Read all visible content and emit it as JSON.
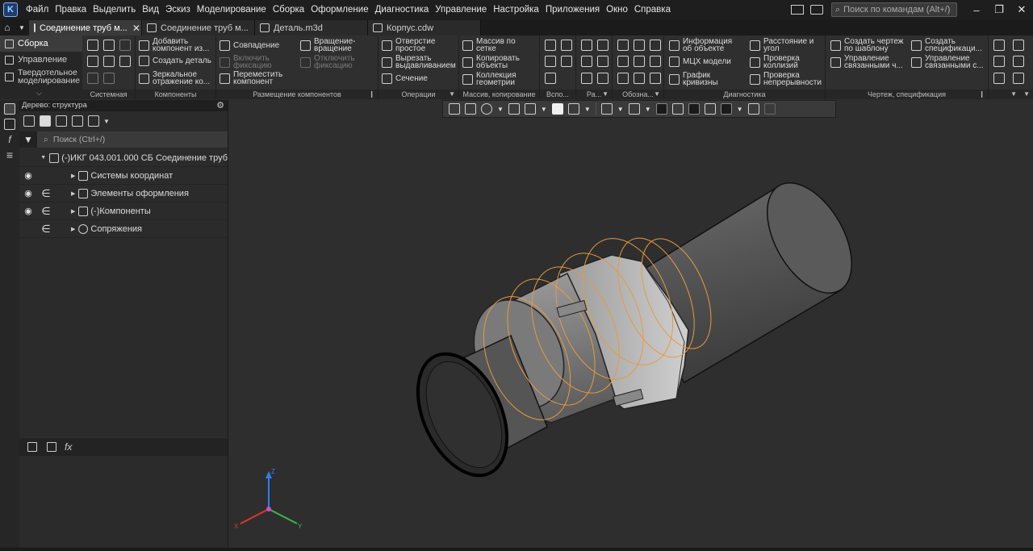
{
  "menubar": {
    "logo": "K",
    "items": [
      "Файл",
      "Правка",
      "Выделить",
      "Вид",
      "Эскиз",
      "Моделирование",
      "Сборка",
      "Оформление",
      "Диагностика",
      "Управление",
      "Настройка",
      "Приложения",
      "Окно",
      "Справка"
    ],
    "search_placeholder": "Поиск по командам (Alt+/)"
  },
  "tabs": [
    {
      "label": "Соединение труб м...",
      "active": true,
      "closable": true
    },
    {
      "label": "Соединение труб м...",
      "active": false,
      "closable": false
    },
    {
      "label": "Деталь.m3d",
      "active": false,
      "closable": false
    },
    {
      "label": "Корпус.cdw",
      "active": false,
      "closable": false
    }
  ],
  "modes": [
    {
      "label": "Сборка",
      "active": true
    },
    {
      "label": "Управление",
      "active": false
    },
    {
      "label": "Твердотельное моделирование",
      "active": false
    }
  ],
  "ribbon": {
    "groups": {
      "system": "Системная",
      "components": "Компоненты",
      "placement": "Размещение компонентов",
      "operations": "Операции",
      "array": "Массив, копирование",
      "auxiliary": "Вспо...",
      "ra": "Ра...",
      "designations": "Обозна...",
      "diagnostics": "Диагностика",
      "drawing": "Чертеж, спецификация"
    },
    "components": {
      "add_line1": "Добавить",
      "add_line2": "компонент из...",
      "create_part": "Создать деталь",
      "mirror_line1": "Зеркальное",
      "mirror_line2": "отражение ко..."
    },
    "placement": {
      "coincidence": "Совпадение",
      "enable_line1": "Включить",
      "enable_line2": "фиксацию",
      "move_line1": "Переместить",
      "move_line2": "компонент",
      "rotate_line1": "Вращение-",
      "rotate_line2": "вращение",
      "disable_line1": "Отключить",
      "disable_line2": "фиксацию"
    },
    "operations": {
      "hole_line1": "Отверстие",
      "hole_line2": "простое",
      "cut_line1": "Вырезать",
      "cut_line2": "выдавливанием",
      "section": "Сечение"
    },
    "array": {
      "grid_line1": "Массив по",
      "grid_line2": "сетке",
      "copy_line1": "Копировать",
      "copy_line2": "объекты",
      "collection_line1": "Коллекция",
      "collection_line2": "геометрии"
    },
    "diagnostics": {
      "info_line1": "Информация",
      "info_line2": "об объекте",
      "mass_props": "МЦХ модели",
      "curvature_line1": "График",
      "curvature_line2": "кривизны",
      "distance_line1": "Расстояние и",
      "distance_line2": "угол",
      "collision_line1": "Проверка",
      "collision_line2": "коллизий",
      "continuity_line1": "Проверка",
      "continuity_line2": "непрерывности"
    },
    "drawing": {
      "create_drawing_line1": "Создать чертеж",
      "create_drawing_line2": "по шаблону",
      "manage_linked_line1": "Управление",
      "manage_linked_line2": "связанными ч...",
      "create_spec_line1": "Создать",
      "create_spec_line2": "спецификаци...",
      "manage_linked2_line1": "Управление",
      "manage_linked2_line2": "связанными с..."
    }
  },
  "tree_panel": {
    "title": "Дерево: структура",
    "search_placeholder": "Поиск (Ctrl+/)",
    "root": "(-)ИКГ 043.001.000 СБ Соединение труб",
    "items": [
      {
        "label": "Системы координат",
        "visible": true,
        "included": false
      },
      {
        "label": "Элементы оформления",
        "visible": true,
        "included": true
      },
      {
        "label": "(-)Компоненты",
        "visible": true,
        "included": true
      },
      {
        "label": "Сопряжения",
        "visible": false,
        "included": true
      }
    ]
  },
  "bottom_panel": {
    "fx_label": "fx"
  },
  "triad": {
    "x_label": "X",
    "y_label": "Y",
    "z_label": "Z"
  },
  "colors": {
    "accent_orange": "#e89a3c",
    "x_axis": "#e0352b",
    "y_axis": "#3ab54a",
    "z_axis": "#2f7ef0"
  }
}
